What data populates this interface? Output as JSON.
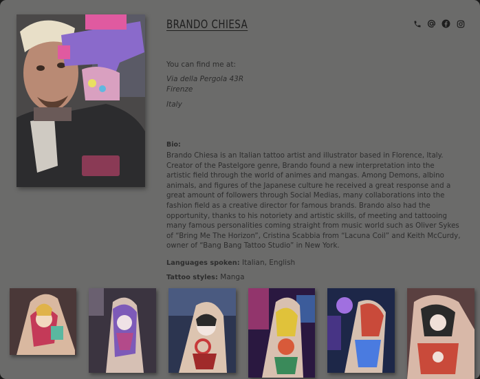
{
  "profile": {
    "name": "BRANDO CHIESA",
    "find_me_label": "You can find me at:",
    "address": {
      "street": "Via della Pergola 43R",
      "city": "Firenze",
      "country": "Italy"
    },
    "bio_label": "Bio:",
    "bio": "Brando Chiesa is an Italian tattoo artist and illustrator based in Florence, Italy. Creator of the Pastelgore genre, Brando found a new interpretation into the artistic field through the world of animes and mangas. Among Demons, albino animals, and figures of the Japanese culture he received a great response and a great amount of followers through Social Medias, many collaborations into the fashion field as a creative director for famous brands. Brando also had the opportunity, thanks to his notoriety and artistic skills, of meeting and tattooing many famous personalities coming straight from music world such as Oliver Sykes of “Bring Me The Horizon”, Cristina Scabbia from “Lacuna Coil” and Keith McCurdy, owner of “Bang Bang Tattoo Studio” in New York.",
    "languages_label": "Languages spoken:",
    "languages": "Italian, English",
    "styles_label": "Tattoo styles:",
    "styles": "Manga"
  },
  "contact_icons": [
    "phone-icon",
    "at-icon",
    "facebook-icon",
    "instagram-icon"
  ],
  "gallery": [
    {
      "name": "tattoo-image-1",
      "bg": "#7d2a3a",
      "accent": "#e0b34a"
    },
    {
      "name": "tattoo-image-2",
      "bg": "#3b2f4a",
      "accent": "#9b6fd0"
    },
    {
      "name": "tattoo-image-3",
      "bg": "#2c3550",
      "accent": "#c73a3a"
    },
    {
      "name": "tattoo-image-4",
      "bg": "#2a1840",
      "accent": "#d84a8a"
    },
    {
      "name": "tattoo-image-5",
      "bg": "#1d2748",
      "accent": "#4a7be0"
    },
    {
      "name": "tattoo-image-6",
      "bg": "#4a2a28",
      "accent": "#c94a3a"
    }
  ],
  "colors": {
    "page_bg": "#6b6b6a",
    "text": "#2d2d2d"
  }
}
